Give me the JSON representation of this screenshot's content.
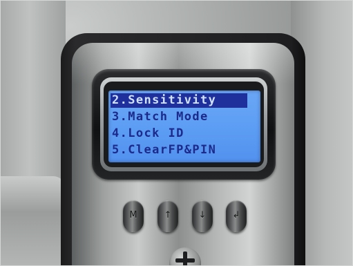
{
  "lcd": {
    "menu_items": [
      {
        "label": "2.Sensitivity",
        "selected": true
      },
      {
        "label": "3.Match Mode",
        "selected": false
      },
      {
        "label": "4.Lock ID",
        "selected": false
      },
      {
        "label": "5.ClearFP&PIN",
        "selected": false
      }
    ]
  },
  "colors": {
    "lcd_background": "#5d9ef4",
    "lcd_text": "#1c2a8c",
    "selection_bar": "#1f2f9c",
    "selection_text": "#cfe1ff"
  },
  "buttons": [
    {
      "name": "menu-button",
      "icon": "menu-icon"
    },
    {
      "name": "up-button",
      "icon": "up-arrow-icon"
    },
    {
      "name": "down-button",
      "icon": "down-arrow-icon"
    },
    {
      "name": "ok-button",
      "icon": "ok-icon"
    }
  ]
}
